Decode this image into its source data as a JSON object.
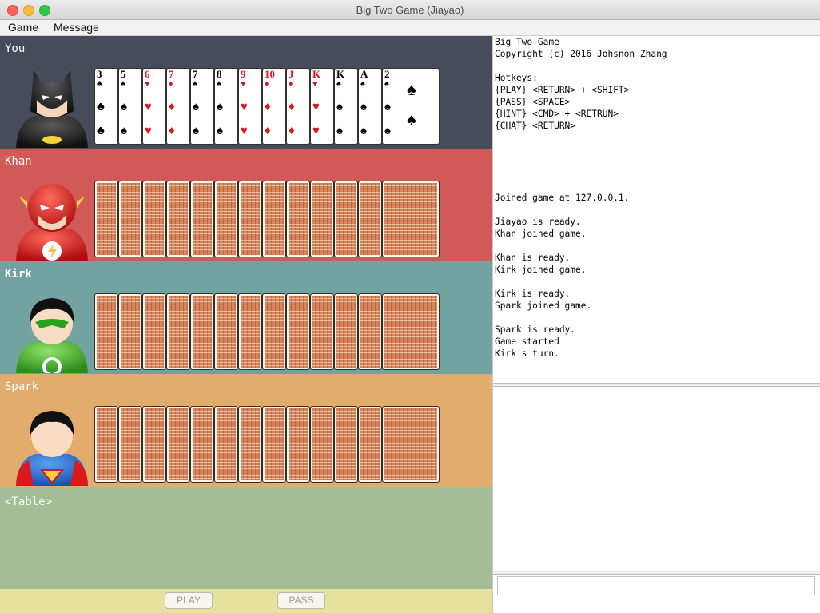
{
  "window": {
    "title": "Big Two Game (Jiayao)"
  },
  "menu": {
    "game": "Game",
    "message": "Message"
  },
  "players": {
    "you": {
      "name": "You",
      "color": "#474c5a"
    },
    "khan": {
      "name": "Khan",
      "color": "#d15a58"
    },
    "kirk": {
      "name": "Kirk",
      "color": "#73a3a1"
    },
    "spark": {
      "name": "Spark",
      "color": "#e2ac6c"
    }
  },
  "hand": [
    {
      "rank": "3",
      "suit": "♣",
      "red": false
    },
    {
      "rank": "5",
      "suit": "♠",
      "red": false
    },
    {
      "rank": "6",
      "suit": "♥",
      "red": true
    },
    {
      "rank": "7",
      "suit": "♦",
      "red": true
    },
    {
      "rank": "7",
      "suit": "♠",
      "red": false
    },
    {
      "rank": "8",
      "suit": "♠",
      "red": false
    },
    {
      "rank": "9",
      "suit": "♥",
      "red": true
    },
    {
      "rank": "10",
      "suit": "♦",
      "red": true
    },
    {
      "rank": "J",
      "suit": "♦",
      "red": true
    },
    {
      "rank": "K",
      "suit": "♥",
      "red": true
    },
    {
      "rank": "K",
      "suit": "♠",
      "red": false
    },
    {
      "rank": "A",
      "suit": "♠",
      "red": false
    },
    {
      "rank": "2",
      "suit": "♠",
      "red": false
    }
  ],
  "opponent_card_count": 13,
  "table": {
    "label": "<Table>"
  },
  "buttons": {
    "play": "PLAY",
    "pass": "PASS"
  },
  "messages": [
    "Big Two Game",
    "Copyright (c) 2016 Johsnon Zhang",
    "",
    "Hotkeys:",
    "{PLAY} <RETURN> + <SHIFT>",
    "{PASS} <SPACE>",
    "{HINT} <CMD> + <RETRUN>",
    "{CHAT} <RETURN>",
    "",
    "",
    "",
    "",
    "",
    "Joined game at 127.0.0.1.",
    "",
    "Jiayao is ready.",
    "Khan joined game.",
    "",
    "Khan is ready.",
    "Kirk joined game.",
    "",
    "Kirk is ready.",
    "Spark joined game.",
    "",
    "Spark is ready.",
    "Game started",
    "Kirk's turn."
  ],
  "chat_input": {
    "value": ""
  }
}
